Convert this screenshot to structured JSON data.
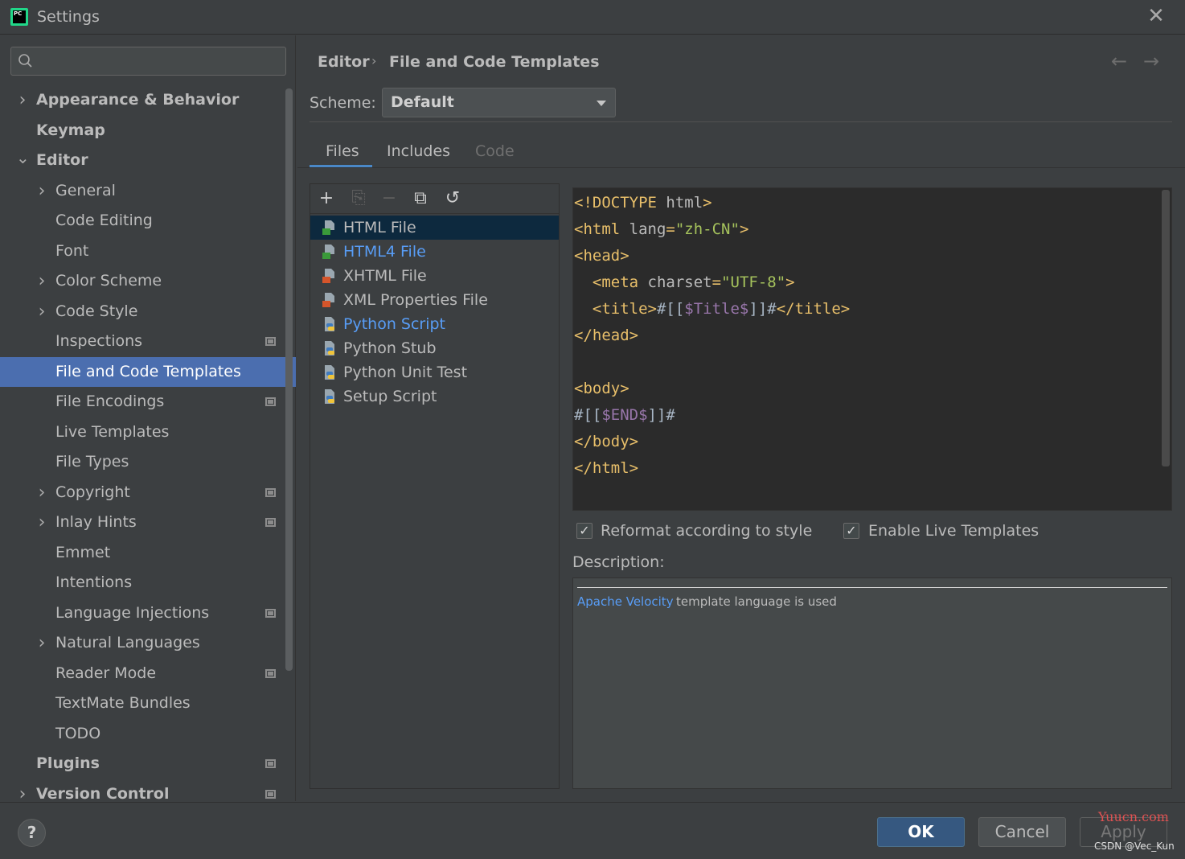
{
  "window": {
    "title": "Settings",
    "app_icon_text": "PC"
  },
  "search": {
    "placeholder": ""
  },
  "sidebar": {
    "items": [
      {
        "label": "Appearance & Behavior",
        "level": 0,
        "expandable": true,
        "expanded": false
      },
      {
        "label": "Keymap",
        "level": 0
      },
      {
        "label": "Editor",
        "level": 0,
        "expandable": true,
        "expanded": true
      },
      {
        "label": "General",
        "level": 1,
        "expandable": true
      },
      {
        "label": "Code Editing",
        "level": 1
      },
      {
        "label": "Font",
        "level": 1
      },
      {
        "label": "Color Scheme",
        "level": 1,
        "expandable": true
      },
      {
        "label": "Code Style",
        "level": 1,
        "expandable": true
      },
      {
        "label": "Inspections",
        "level": 1,
        "project_badge": true
      },
      {
        "label": "File and Code Templates",
        "level": 1,
        "selected": true
      },
      {
        "label": "File Encodings",
        "level": 1,
        "project_badge": true
      },
      {
        "label": "Live Templates",
        "level": 1
      },
      {
        "label": "File Types",
        "level": 1
      },
      {
        "label": "Copyright",
        "level": 1,
        "expandable": true,
        "project_badge": true
      },
      {
        "label": "Inlay Hints",
        "level": 1,
        "expandable": true,
        "project_badge": true
      },
      {
        "label": "Emmet",
        "level": 1
      },
      {
        "label": "Intentions",
        "level": 1
      },
      {
        "label": "Language Injections",
        "level": 1,
        "project_badge": true
      },
      {
        "label": "Natural Languages",
        "level": 1,
        "expandable": true
      },
      {
        "label": "Reader Mode",
        "level": 1,
        "project_badge": true
      },
      {
        "label": "TextMate Bundles",
        "level": 1
      },
      {
        "label": "TODO",
        "level": 1
      },
      {
        "label": "Plugins",
        "level": 0,
        "project_badge": true
      },
      {
        "label": "Version Control",
        "level": 0,
        "expandable": true,
        "project_badge": true
      }
    ]
  },
  "breadcrumb": {
    "section": "Editor",
    "separator": "›",
    "page": "File and Code Templates"
  },
  "scheme": {
    "label": "Scheme:",
    "value": "Default"
  },
  "tabs": [
    {
      "label": "Files",
      "active": true
    },
    {
      "label": "Includes"
    },
    {
      "label": "Code",
      "disabled": true
    }
  ],
  "toolbar": {
    "add": "+",
    "copy_child": "⎘",
    "remove": "−",
    "copy": "⧉",
    "reset": "↺"
  },
  "files": [
    {
      "label": "HTML File",
      "icon": "html-file-icon",
      "selected": true
    },
    {
      "label": "HTML4 File",
      "icon": "html-file-icon",
      "link": true
    },
    {
      "label": "XHTML File",
      "icon": "xhtml-file-icon"
    },
    {
      "label": "XML Properties File",
      "icon": "xml-file-icon"
    },
    {
      "label": "Python Script",
      "icon": "python-file-icon",
      "link": true
    },
    {
      "label": "Python Stub",
      "icon": "python-file-icon"
    },
    {
      "label": "Python Unit Test",
      "icon": "python-file-icon"
    },
    {
      "label": "Setup Script",
      "icon": "python-file-icon"
    }
  ],
  "code": {
    "lines": [
      [
        [
          "c-tag",
          "<!DOCTYPE "
        ],
        [
          "c-attr",
          "html"
        ],
        [
          "c-tag",
          ">"
        ]
      ],
      [
        [
          "c-tag",
          "<html "
        ],
        [
          "c-attr",
          "lang"
        ],
        [
          "c-tag",
          "="
        ],
        [
          "c-str",
          "\"zh-CN\""
        ],
        [
          "c-tag",
          ">"
        ]
      ],
      [
        [
          "c-tag",
          "<head>"
        ]
      ],
      [
        [
          "c-plain",
          "  "
        ],
        [
          "c-tag",
          "<meta "
        ],
        [
          "c-attr",
          "charset"
        ],
        [
          "c-tag",
          "="
        ],
        [
          "c-str",
          "\"UTF-8\""
        ],
        [
          "c-tag",
          ">"
        ]
      ],
      [
        [
          "c-plain",
          "  "
        ],
        [
          "c-tag",
          "<title>"
        ],
        [
          "c-plain",
          "#[["
        ],
        [
          "c-var",
          "$Title$"
        ],
        [
          "c-plain",
          "]]#"
        ],
        [
          "c-tag",
          "</title>"
        ]
      ],
      [
        [
          "c-tag",
          "</head>"
        ]
      ],
      [
        [
          "c-plain",
          ""
        ]
      ],
      [
        [
          "c-tag",
          "<body>"
        ]
      ],
      [
        [
          "c-plain",
          "#[["
        ],
        [
          "c-var",
          "$END$"
        ],
        [
          "c-plain",
          "]]#"
        ]
      ],
      [
        [
          "c-tag",
          "</body>"
        ]
      ],
      [
        [
          "c-tag",
          "</html>"
        ]
      ]
    ]
  },
  "options": {
    "reformat": {
      "label": "Reformat according to style",
      "checked": true
    },
    "live_templates": {
      "label": "Enable Live Templates",
      "checked": true
    }
  },
  "description": {
    "label": "Description:",
    "link_text": "Apache Velocity",
    "text": "template language is used"
  },
  "buttons": {
    "help": "?",
    "ok": "OK",
    "cancel": "Cancel",
    "apply": "Apply"
  },
  "watermarks": {
    "site": "Yuucn.com",
    "author": "CSDN @Vec_Kun"
  },
  "colors": {
    "selection": "#4b6eaf",
    "accent": "#4a88c7",
    "link": "#589df6",
    "ok_button": "#365880"
  }
}
